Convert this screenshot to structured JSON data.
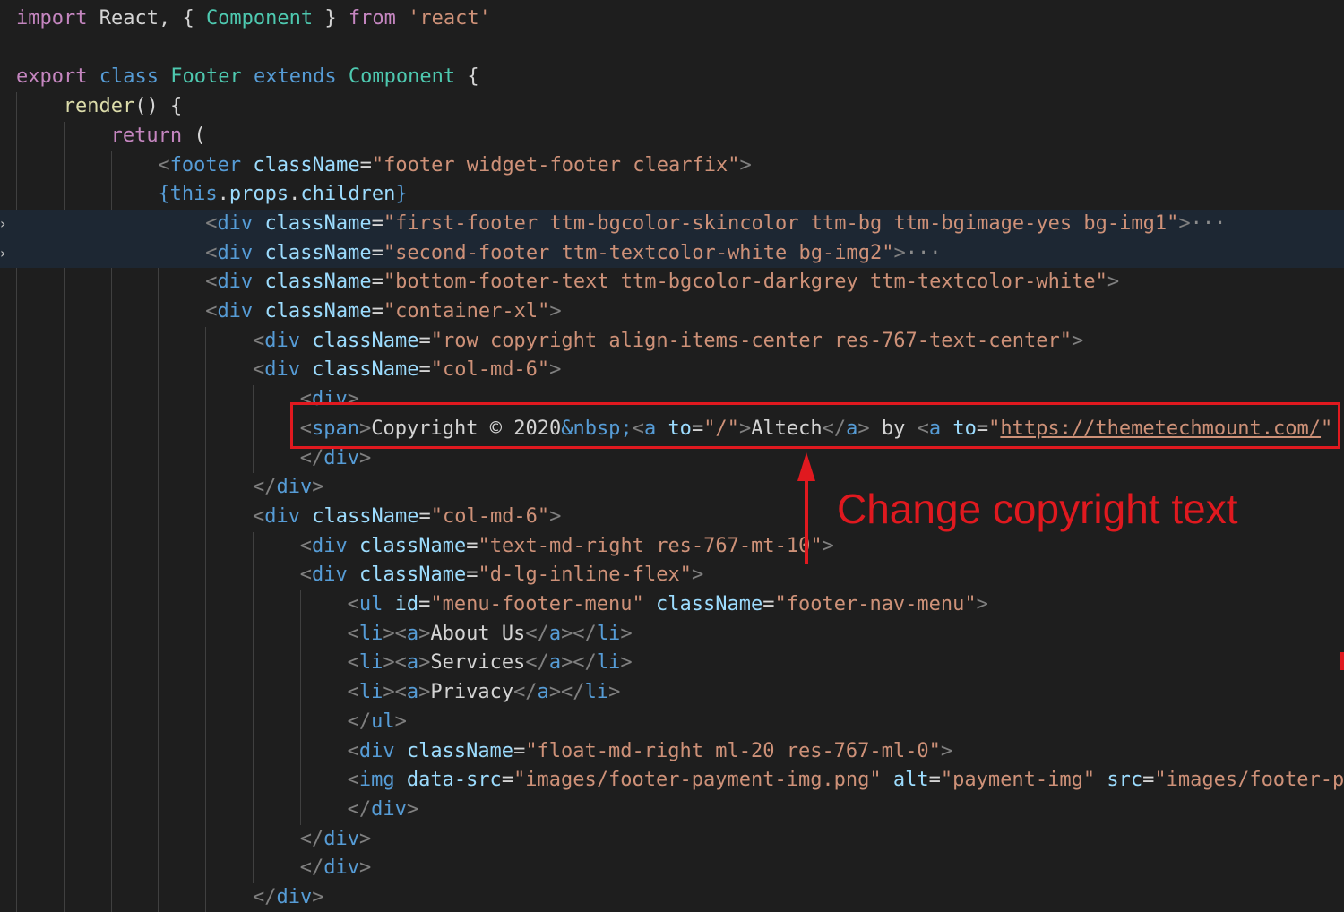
{
  "colors": {
    "background": "#1e1e1e",
    "annotation_red": "#e0191f",
    "folded_line_bg": "#1d2733"
  },
  "lines": [
    {
      "indent": 0,
      "folded": false,
      "tokens": [
        {
          "t": "kw",
          "v": "import"
        },
        {
          "t": "txt",
          "v": " React, { "
        },
        {
          "t": "cls",
          "v": "Component"
        },
        {
          "t": "txt",
          "v": " } "
        },
        {
          "t": "kw",
          "v": "from"
        },
        {
          "t": "txt",
          "v": " "
        },
        {
          "t": "str",
          "v": "'react'"
        }
      ]
    },
    {
      "indent": 0,
      "folded": false,
      "tokens": []
    },
    {
      "indent": 0,
      "folded": false,
      "tokens": [
        {
          "t": "kw",
          "v": "export"
        },
        {
          "t": "txt",
          "v": " "
        },
        {
          "t": "blue",
          "v": "class"
        },
        {
          "t": "txt",
          "v": " "
        },
        {
          "t": "cls",
          "v": "Footer"
        },
        {
          "t": "txt",
          "v": " "
        },
        {
          "t": "blue",
          "v": "extends"
        },
        {
          "t": "txt",
          "v": " "
        },
        {
          "t": "cls",
          "v": "Component"
        },
        {
          "t": "txt",
          "v": " {"
        }
      ]
    },
    {
      "indent": 1,
      "folded": false,
      "tokens": [
        {
          "t": "fn",
          "v": "render"
        },
        {
          "t": "txt",
          "v": "() {"
        }
      ]
    },
    {
      "indent": 2,
      "folded": false,
      "tokens": [
        {
          "t": "kw",
          "v": "return"
        },
        {
          "t": "txt",
          "v": " ("
        }
      ]
    },
    {
      "indent": 3,
      "folded": false,
      "tokens": [
        {
          "t": "br",
          "v": "<"
        },
        {
          "t": "tag",
          "v": "footer"
        },
        {
          "t": "txt",
          "v": " "
        },
        {
          "t": "var",
          "v": "className"
        },
        {
          "t": "txt",
          "v": "="
        },
        {
          "t": "str",
          "v": "\"footer widget-footer clearfix\""
        },
        {
          "t": "br",
          "v": ">"
        }
      ]
    },
    {
      "indent": 3,
      "folded": false,
      "tokens": [
        {
          "t": "blue",
          "v": "{"
        },
        {
          "t": "blue",
          "v": "this"
        },
        {
          "t": "txt",
          "v": "."
        },
        {
          "t": "var",
          "v": "props"
        },
        {
          "t": "txt",
          "v": "."
        },
        {
          "t": "var",
          "v": "children"
        },
        {
          "t": "blue",
          "v": "}"
        }
      ]
    },
    {
      "indent": 4,
      "folded": true,
      "tokens": [
        {
          "t": "br",
          "v": "<"
        },
        {
          "t": "tag",
          "v": "div"
        },
        {
          "t": "txt",
          "v": " "
        },
        {
          "t": "var",
          "v": "className"
        },
        {
          "t": "txt",
          "v": "="
        },
        {
          "t": "str",
          "v": "\"first-footer ttm-bgcolor-skincolor ttm-bg ttm-bgimage-yes bg-img1\""
        },
        {
          "t": "br",
          "v": ">"
        },
        {
          "t": "ell",
          "v": "···"
        }
      ]
    },
    {
      "indent": 4,
      "folded": true,
      "tokens": [
        {
          "t": "br",
          "v": "<"
        },
        {
          "t": "tag",
          "v": "div"
        },
        {
          "t": "txt",
          "v": " "
        },
        {
          "t": "var",
          "v": "className"
        },
        {
          "t": "txt",
          "v": "="
        },
        {
          "t": "str",
          "v": "\"second-footer ttm-textcolor-white bg-img2\""
        },
        {
          "t": "br",
          "v": ">"
        },
        {
          "t": "ell",
          "v": "···"
        }
      ]
    },
    {
      "indent": 4,
      "folded": false,
      "tokens": [
        {
          "t": "br",
          "v": "<"
        },
        {
          "t": "tag",
          "v": "div"
        },
        {
          "t": "txt",
          "v": " "
        },
        {
          "t": "var",
          "v": "className"
        },
        {
          "t": "txt",
          "v": "="
        },
        {
          "t": "str",
          "v": "\"bottom-footer-text ttm-bgcolor-darkgrey ttm-textcolor-white\""
        },
        {
          "t": "br",
          "v": ">"
        }
      ]
    },
    {
      "indent": 4,
      "folded": false,
      "tokens": [
        {
          "t": "br",
          "v": "<"
        },
        {
          "t": "tag",
          "v": "div"
        },
        {
          "t": "txt",
          "v": " "
        },
        {
          "t": "var",
          "v": "className"
        },
        {
          "t": "txt",
          "v": "="
        },
        {
          "t": "str",
          "v": "\"container-xl\""
        },
        {
          "t": "br",
          "v": ">"
        }
      ]
    },
    {
      "indent": 5,
      "folded": false,
      "tokens": [
        {
          "t": "br",
          "v": "<"
        },
        {
          "t": "tag",
          "v": "div"
        },
        {
          "t": "txt",
          "v": " "
        },
        {
          "t": "var",
          "v": "className"
        },
        {
          "t": "txt",
          "v": "="
        },
        {
          "t": "str",
          "v": "\"row copyright align-items-center res-767-text-center\""
        },
        {
          "t": "br",
          "v": ">"
        }
      ]
    },
    {
      "indent": 5,
      "folded": false,
      "tokens": [
        {
          "t": "br",
          "v": "<"
        },
        {
          "t": "tag",
          "v": "div"
        },
        {
          "t": "txt",
          "v": " "
        },
        {
          "t": "var",
          "v": "className"
        },
        {
          "t": "txt",
          "v": "="
        },
        {
          "t": "str",
          "v": "\"col-md-6\""
        },
        {
          "t": "br",
          "v": ">"
        }
      ]
    },
    {
      "indent": 6,
      "folded": false,
      "tokens": [
        {
          "t": "br",
          "v": "<"
        },
        {
          "t": "tag",
          "v": "div"
        },
        {
          "t": "br",
          "v": ">"
        }
      ]
    },
    {
      "indent": 6,
      "folded": false,
      "tokens": [
        {
          "t": "br",
          "v": "<"
        },
        {
          "t": "tag",
          "v": "span"
        },
        {
          "t": "br",
          "v": ">"
        },
        {
          "t": "txt",
          "v": "Copyright © 2020"
        },
        {
          "t": "ent",
          "v": "&nbsp;"
        },
        {
          "t": "br",
          "v": "<"
        },
        {
          "t": "tag",
          "v": "a"
        },
        {
          "t": "txt",
          "v": " "
        },
        {
          "t": "var",
          "v": "to"
        },
        {
          "t": "txt",
          "v": "="
        },
        {
          "t": "str",
          "v": "\"/\""
        },
        {
          "t": "br",
          "v": ">"
        },
        {
          "t": "txt",
          "v": "Altech"
        },
        {
          "t": "br",
          "v": "</"
        },
        {
          "t": "tag",
          "v": "a"
        },
        {
          "t": "br",
          "v": ">"
        },
        {
          "t": "txt",
          "v": " by "
        },
        {
          "t": "br",
          "v": "<"
        },
        {
          "t": "tag",
          "v": "a"
        },
        {
          "t": "txt",
          "v": " "
        },
        {
          "t": "var",
          "v": "to"
        },
        {
          "t": "txt",
          "v": "="
        },
        {
          "t": "str",
          "v": "\""
        },
        {
          "t": "link",
          "v": "https://themetechmount.com/"
        },
        {
          "t": "str",
          "v": "\""
        }
      ]
    },
    {
      "indent": 6,
      "folded": false,
      "tokens": [
        {
          "t": "br",
          "v": "</"
        },
        {
          "t": "tag",
          "v": "div"
        },
        {
          "t": "br",
          "v": ">"
        }
      ]
    },
    {
      "indent": 5,
      "folded": false,
      "tokens": [
        {
          "t": "br",
          "v": "</"
        },
        {
          "t": "tag",
          "v": "div"
        },
        {
          "t": "br",
          "v": ">"
        }
      ]
    },
    {
      "indent": 5,
      "folded": false,
      "tokens": [
        {
          "t": "br",
          "v": "<"
        },
        {
          "t": "tag",
          "v": "div"
        },
        {
          "t": "txt",
          "v": " "
        },
        {
          "t": "var",
          "v": "className"
        },
        {
          "t": "txt",
          "v": "="
        },
        {
          "t": "str",
          "v": "\"col-md-6\""
        },
        {
          "t": "br",
          "v": ">"
        }
      ]
    },
    {
      "indent": 6,
      "folded": false,
      "tokens": [
        {
          "t": "br",
          "v": "<"
        },
        {
          "t": "tag",
          "v": "div"
        },
        {
          "t": "txt",
          "v": " "
        },
        {
          "t": "var",
          "v": "className"
        },
        {
          "t": "txt",
          "v": "="
        },
        {
          "t": "str",
          "v": "\"text-md-right res-767-mt-10\""
        },
        {
          "t": "br",
          "v": ">"
        }
      ]
    },
    {
      "indent": 6,
      "folded": false,
      "tokens": [
        {
          "t": "br",
          "v": "<"
        },
        {
          "t": "tag",
          "v": "div"
        },
        {
          "t": "txt",
          "v": " "
        },
        {
          "t": "var",
          "v": "className"
        },
        {
          "t": "txt",
          "v": "="
        },
        {
          "t": "str",
          "v": "\"d-lg-inline-flex\""
        },
        {
          "t": "br",
          "v": ">"
        }
      ]
    },
    {
      "indent": 7,
      "folded": false,
      "tokens": [
        {
          "t": "br",
          "v": "<"
        },
        {
          "t": "tag",
          "v": "ul"
        },
        {
          "t": "txt",
          "v": " "
        },
        {
          "t": "var",
          "v": "id"
        },
        {
          "t": "txt",
          "v": "="
        },
        {
          "t": "str",
          "v": "\"menu-footer-menu\""
        },
        {
          "t": "txt",
          "v": " "
        },
        {
          "t": "var",
          "v": "className"
        },
        {
          "t": "txt",
          "v": "="
        },
        {
          "t": "str",
          "v": "\"footer-nav-menu\""
        },
        {
          "t": "br",
          "v": ">"
        }
      ]
    },
    {
      "indent": 7,
      "folded": false,
      "tokens": [
        {
          "t": "br",
          "v": "<"
        },
        {
          "t": "tag",
          "v": "li"
        },
        {
          "t": "br",
          "v": "><"
        },
        {
          "t": "tag",
          "v": "a"
        },
        {
          "t": "br",
          "v": ">"
        },
        {
          "t": "txt",
          "v": "About Us"
        },
        {
          "t": "br",
          "v": "</"
        },
        {
          "t": "tag",
          "v": "a"
        },
        {
          "t": "br",
          "v": "></"
        },
        {
          "t": "tag",
          "v": "li"
        },
        {
          "t": "br",
          "v": ">"
        }
      ]
    },
    {
      "indent": 7,
      "folded": false,
      "tokens": [
        {
          "t": "br",
          "v": "<"
        },
        {
          "t": "tag",
          "v": "li"
        },
        {
          "t": "br",
          "v": "><"
        },
        {
          "t": "tag",
          "v": "a"
        },
        {
          "t": "br",
          "v": ">"
        },
        {
          "t": "txt",
          "v": "Services"
        },
        {
          "t": "br",
          "v": "</"
        },
        {
          "t": "tag",
          "v": "a"
        },
        {
          "t": "br",
          "v": "></"
        },
        {
          "t": "tag",
          "v": "li"
        },
        {
          "t": "br",
          "v": ">"
        }
      ]
    },
    {
      "indent": 7,
      "folded": false,
      "tokens": [
        {
          "t": "br",
          "v": "<"
        },
        {
          "t": "tag",
          "v": "li"
        },
        {
          "t": "br",
          "v": "><"
        },
        {
          "t": "tag",
          "v": "a"
        },
        {
          "t": "br",
          "v": ">"
        },
        {
          "t": "txt",
          "v": "Privacy"
        },
        {
          "t": "br",
          "v": "</"
        },
        {
          "t": "tag",
          "v": "a"
        },
        {
          "t": "br",
          "v": "></"
        },
        {
          "t": "tag",
          "v": "li"
        },
        {
          "t": "br",
          "v": ">"
        }
      ]
    },
    {
      "indent": 7,
      "folded": false,
      "tokens": [
        {
          "t": "br",
          "v": "</"
        },
        {
          "t": "tag",
          "v": "ul"
        },
        {
          "t": "br",
          "v": ">"
        }
      ]
    },
    {
      "indent": 7,
      "folded": false,
      "tokens": [
        {
          "t": "br",
          "v": "<"
        },
        {
          "t": "tag",
          "v": "div"
        },
        {
          "t": "txt",
          "v": " "
        },
        {
          "t": "var",
          "v": "className"
        },
        {
          "t": "txt",
          "v": "="
        },
        {
          "t": "str",
          "v": "\"float-md-right ml-20 res-767-ml-0\""
        },
        {
          "t": "br",
          "v": ">"
        }
      ]
    },
    {
      "indent": 7,
      "folded": false,
      "tokens": [
        {
          "t": "br",
          "v": "<"
        },
        {
          "t": "tag",
          "v": "img"
        },
        {
          "t": "txt",
          "v": " "
        },
        {
          "t": "var",
          "v": "data-src"
        },
        {
          "t": "txt",
          "v": "="
        },
        {
          "t": "str",
          "v": "\"images/footer-payment-img.png\""
        },
        {
          "t": "txt",
          "v": " "
        },
        {
          "t": "var",
          "v": "alt"
        },
        {
          "t": "txt",
          "v": "="
        },
        {
          "t": "str",
          "v": "\"payment-img\""
        },
        {
          "t": "txt",
          "v": " "
        },
        {
          "t": "var",
          "v": "src"
        },
        {
          "t": "txt",
          "v": "="
        },
        {
          "t": "str",
          "v": "\"images/footer-p"
        }
      ]
    },
    {
      "indent": 7,
      "folded": false,
      "tokens": [
        {
          "t": "br",
          "v": "</"
        },
        {
          "t": "tag",
          "v": "div"
        },
        {
          "t": "br",
          "v": ">"
        }
      ]
    },
    {
      "indent": 6,
      "folded": false,
      "tokens": [
        {
          "t": "br",
          "v": "</"
        },
        {
          "t": "tag",
          "v": "div"
        },
        {
          "t": "br",
          "v": ">"
        }
      ]
    },
    {
      "indent": 6,
      "folded": false,
      "tokens": [
        {
          "t": "br",
          "v": "</"
        },
        {
          "t": "tag",
          "v": "div"
        },
        {
          "t": "br",
          "v": ">"
        }
      ]
    },
    {
      "indent": 5,
      "folded": false,
      "tokens": [
        {
          "t": "br",
          "v": "</"
        },
        {
          "t": "tag",
          "v": "div"
        },
        {
          "t": "br",
          "v": ">"
        }
      ]
    }
  ],
  "annotation": {
    "label": "Change copyright text"
  }
}
